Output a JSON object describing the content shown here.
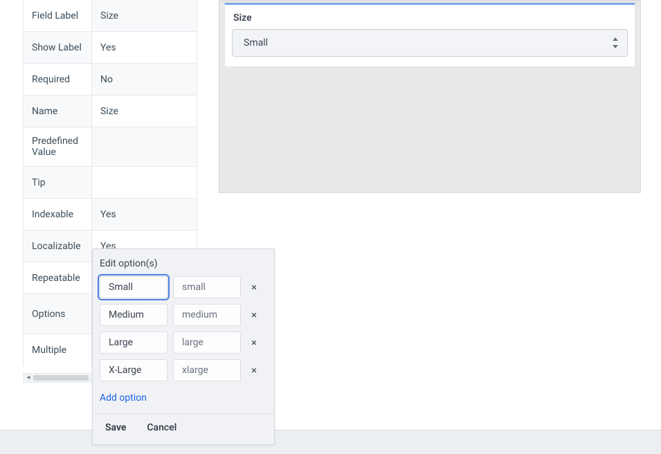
{
  "properties": {
    "field_label": {
      "label": "Field Label",
      "value": "Size"
    },
    "show_label": {
      "label": "Show Label",
      "value": "Yes"
    },
    "required": {
      "label": "Required",
      "value": "No"
    },
    "name": {
      "label": "Name",
      "value": "Size"
    },
    "predefined_value": {
      "label": "Predefined Value",
      "value": ""
    },
    "tip": {
      "label": "Tip",
      "value": ""
    },
    "indexable": {
      "label": "Indexable",
      "value": "Yes"
    },
    "localizable": {
      "label": "Localizable",
      "value": "Yes"
    },
    "repeatable": {
      "label": "Repeatable",
      "value": ""
    },
    "options": {
      "label": "Options",
      "value": ""
    },
    "multiple": {
      "label": "Multiple",
      "value": ""
    }
  },
  "preview": {
    "field_title": "Size",
    "selected_value": "Small"
  },
  "edit_options": {
    "title": "Edit option(s)",
    "rows": [
      {
        "label": "Small",
        "value": "small"
      },
      {
        "label": "Medium",
        "value": "medium"
      },
      {
        "label": "Large",
        "value": "large"
      },
      {
        "label": "X-Large",
        "value": "xlarge"
      }
    ],
    "add_option_label": "Add option",
    "save_label": "Save",
    "cancel_label": "Cancel"
  }
}
